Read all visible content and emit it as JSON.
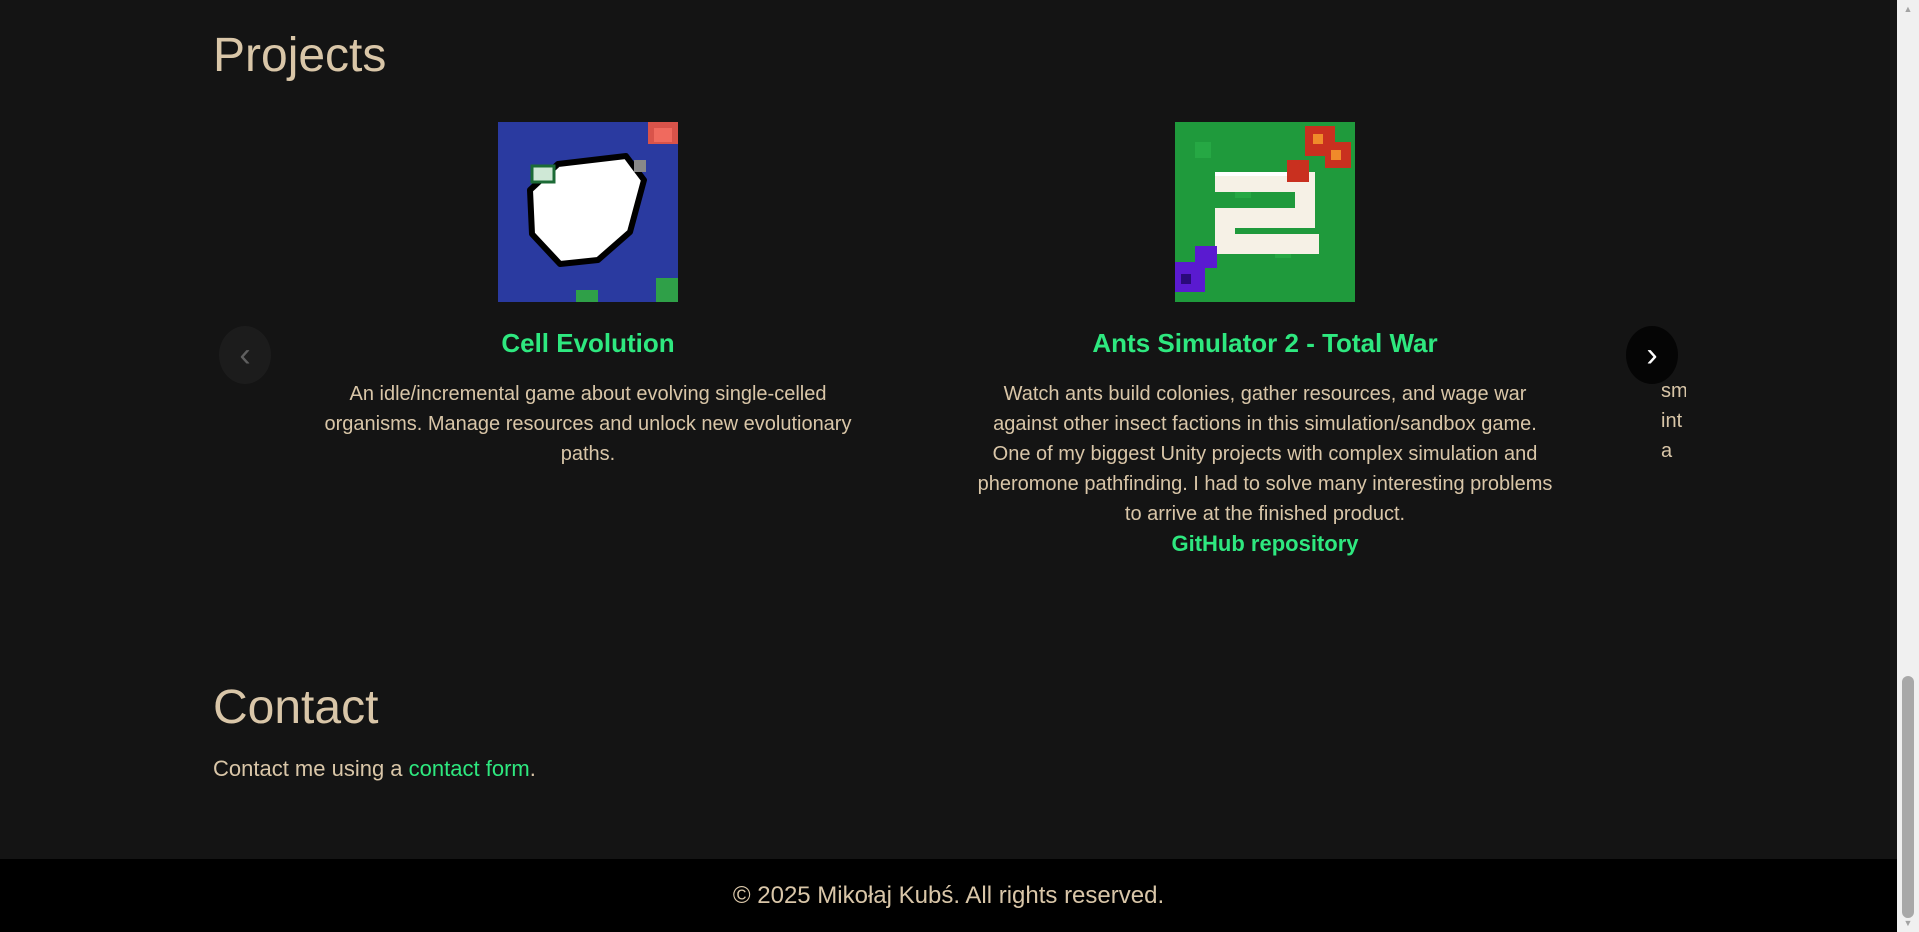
{
  "projects": {
    "title": "Projects",
    "prev_label": "‹",
    "next_label": "›",
    "cards": [
      {
        "title": "Cell Evolution",
        "description": "An idle/incremental game about evolving single-celled organisms. Manage resources and unlock new evolutionary paths.",
        "link": ""
      },
      {
        "title": "Ants Simulator 2 - Total War",
        "description": "Watch ants build colonies, gather resources, and wage war against other insect factions in this simulation/sandbox game. One of my biggest Unity projects with complex simulation and pheromone pathfinding. I had to solve many interesting problems to arrive at the finished product.",
        "link": "GitHub repository"
      },
      {
        "title": "",
        "description": "sm int a",
        "link": ""
      }
    ]
  },
  "contact": {
    "title": "Contact",
    "text_before": "Contact me using a ",
    "link_text": "contact form",
    "text_after": "."
  },
  "footer": {
    "text": "© 2025 Mikołaj Kubś. All rights reserved."
  },
  "colors": {
    "background": "#141414",
    "text": "#d9c6a8",
    "accent": "#2ee87f",
    "footer_bg": "#000000"
  }
}
